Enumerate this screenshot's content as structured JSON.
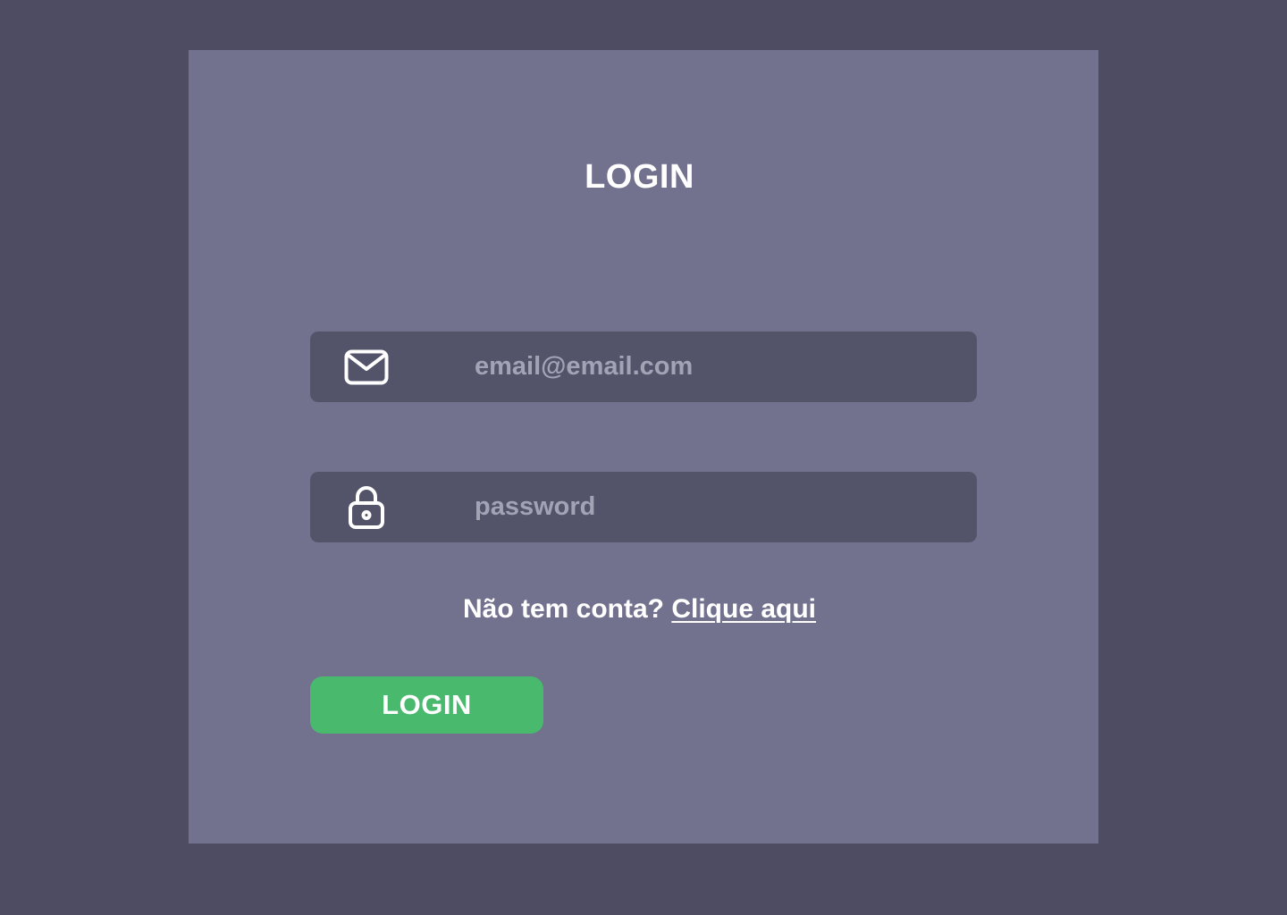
{
  "page": {
    "title": "LOGIN"
  },
  "form": {
    "email": {
      "icon": "mail-icon",
      "placeholder": "email@email.com",
      "value": ""
    },
    "password": {
      "icon": "lock-icon",
      "placeholder": "password",
      "value": ""
    },
    "signup_prompt": "Não tem conta? ",
    "signup_link": "Clique aqui",
    "submit_label": "LOGIN"
  },
  "colors": {
    "background": "#4e4c62",
    "card": "#72728f",
    "field": "#53546a",
    "placeholder": "#a3a3b6",
    "accent_green": "#48b96d",
    "text": "#ffffff"
  }
}
